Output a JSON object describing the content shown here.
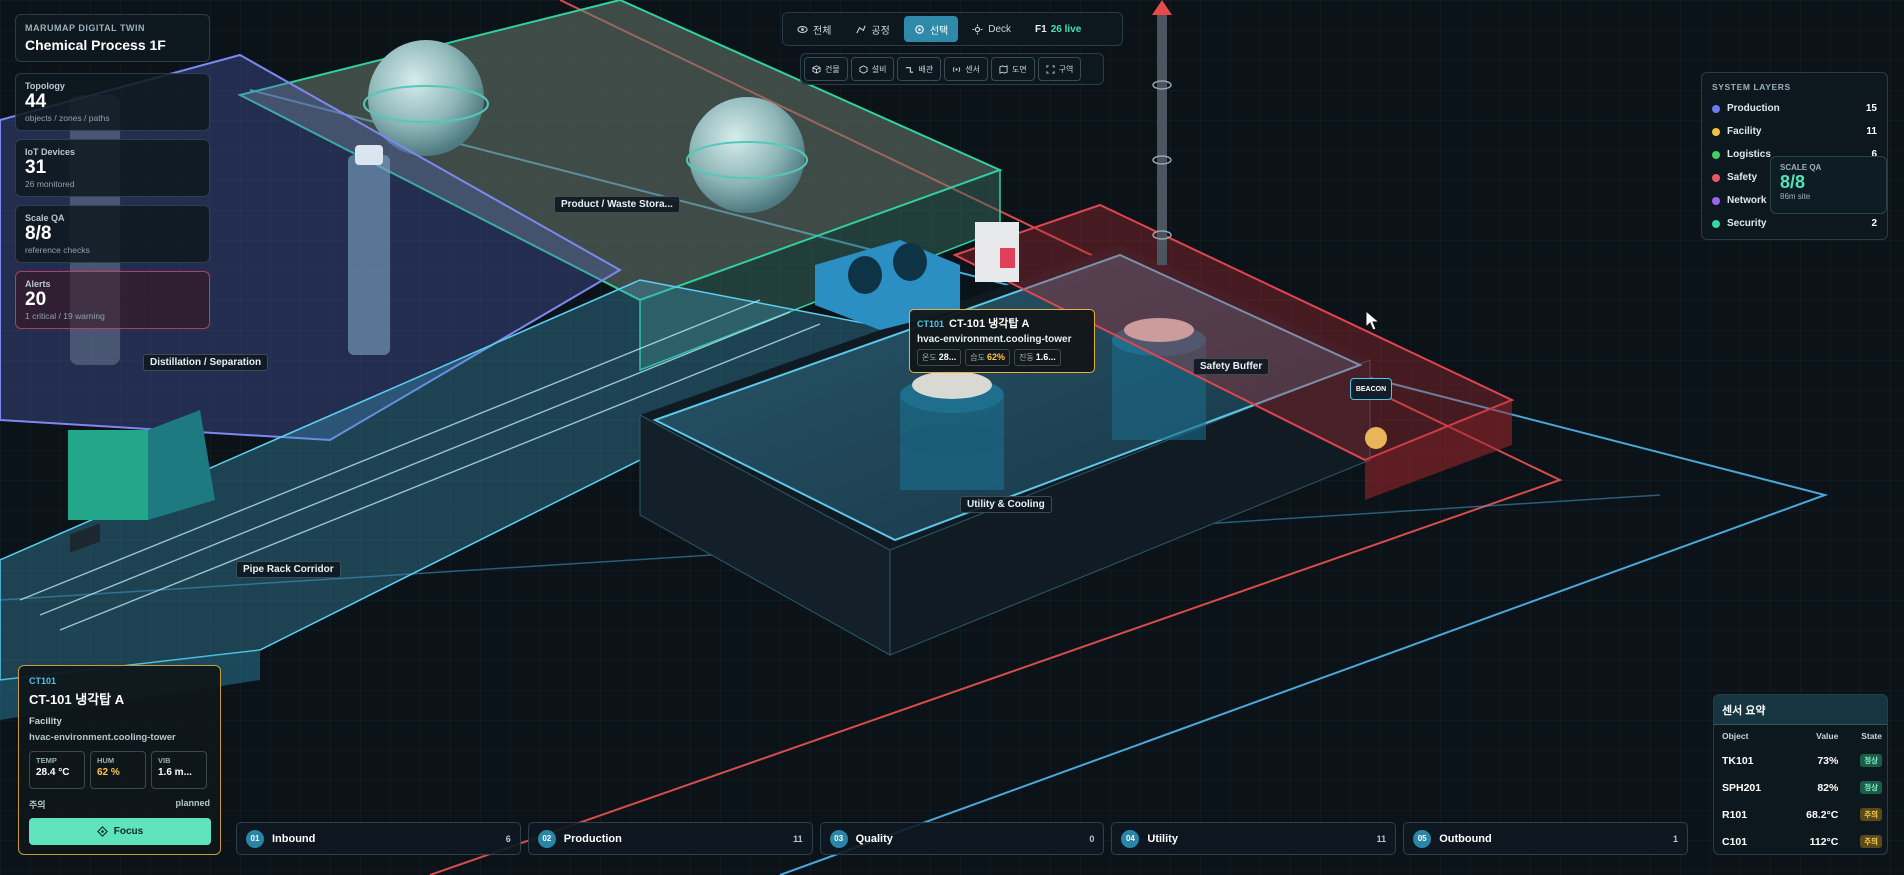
{
  "app": {
    "subtitle": "MARUMAP DIGITAL TWIN",
    "title": "Chemical Process 1F"
  },
  "stats": [
    {
      "label": "Topology",
      "value": "44",
      "sub": "objects / zones / paths"
    },
    {
      "label": "IoT Devices",
      "value": "31",
      "sub": "26 monitored"
    },
    {
      "label": "Scale QA",
      "value": "8/8",
      "sub": "reference checks"
    },
    {
      "label": "Alerts",
      "value": "20",
      "sub": "1 critical / 19 warning"
    }
  ],
  "toolbar": {
    "views": [
      {
        "label": "전체",
        "icon": "eye-icon"
      },
      {
        "label": "공정",
        "icon": "route-icon"
      },
      {
        "label": "선택",
        "icon": "target-icon"
      },
      {
        "label": "Deck",
        "icon": "sun-icon"
      }
    ],
    "floor": "F1",
    "live": "26 live",
    "filters": [
      {
        "label": "건물",
        "icon": "cube-icon"
      },
      {
        "label": "설비",
        "icon": "box-icon"
      },
      {
        "label": "배관",
        "icon": "pipe-icon"
      },
      {
        "label": "센서",
        "icon": "antenna-icon"
      },
      {
        "label": "도면",
        "icon": "map-icon"
      },
      {
        "label": "구역",
        "icon": "frame-icon"
      }
    ]
  },
  "layers": {
    "title": "SYSTEM LAYERS",
    "items": [
      {
        "name": "Production",
        "count": "15",
        "color": "#6a7cf0"
      },
      {
        "name": "Facility",
        "count": "11",
        "color": "#f0c040"
      },
      {
        "name": "Logistics",
        "count": "6",
        "color": "#3fcf6a"
      },
      {
        "name": "Safety",
        "count": "",
        "color": "#f05566"
      },
      {
        "name": "Network",
        "count": "",
        "color": "#9a66f0"
      },
      {
        "name": "Security",
        "count": "2",
        "color": "#38d6a0"
      }
    ]
  },
  "scale_popup": {
    "label": "SCALE QA",
    "value": "8/8",
    "sub": "86m site"
  },
  "scene_labels": {
    "product": "Product / Waste Stora...",
    "distillation": "Distillation / Separation",
    "safety": "Safety Buffer",
    "utility": "Utility & Cooling",
    "pipe": "Pipe Rack Corridor",
    "beacon": "BEACON"
  },
  "tooltip": {
    "id": "CT101",
    "name": "CT-101 냉각탑 A",
    "template": "hvac-environment.cooling-tower",
    "chips": [
      {
        "k": "온도",
        "v": "28..."
      },
      {
        "k": "습도",
        "v": "62%"
      },
      {
        "k": "진동",
        "v": "1.6..."
      }
    ]
  },
  "detail": {
    "id": "CT101",
    "name": "CT-101 냉각탑 A",
    "category": "Facility",
    "template": "hvac-environment.cooling-tower",
    "metrics": [
      {
        "k": "TEMP",
        "v": "28.4 °C"
      },
      {
        "k": "HUM",
        "v": "62 %"
      },
      {
        "k": "VIB",
        "v": "1.6 m..."
      }
    ],
    "status": "주의",
    "plan": "planned",
    "focus_label": "Focus"
  },
  "stages": [
    {
      "num": "01",
      "name": "Inbound",
      "count": "6"
    },
    {
      "num": "02",
      "name": "Production",
      "count": "11"
    },
    {
      "num": "03",
      "name": "Quality",
      "count": "0"
    },
    {
      "num": "04",
      "name": "Utility",
      "count": "11"
    },
    {
      "num": "05",
      "name": "Outbound",
      "count": "1"
    }
  ],
  "sensors": {
    "title": "센서 요약",
    "headers": [
      "Object",
      "Value",
      "State"
    ],
    "rows": [
      {
        "obj": "TK101",
        "val": "73%",
        "state": "정상"
      },
      {
        "obj": "SPH201",
        "val": "82%",
        "state": "정상"
      },
      {
        "obj": "R101",
        "val": "68.2°C",
        "state": "주의"
      },
      {
        "obj": "C101",
        "val": "112°C",
        "state": "주의"
      }
    ]
  }
}
